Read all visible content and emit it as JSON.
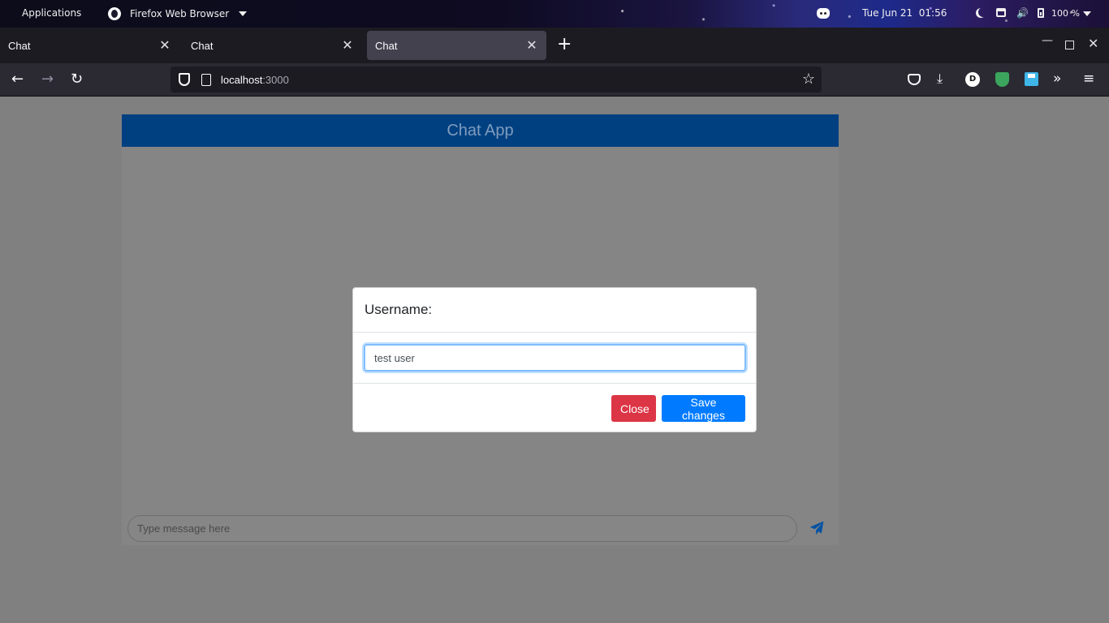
{
  "topbar": {
    "applications": "Applications",
    "app_name": "Firefox Web Browser",
    "clock": "Tue Jun 21  01:56",
    "battery_pct": "100 %"
  },
  "tabs": [
    {
      "title": "Chat",
      "active": false
    },
    {
      "title": "Chat",
      "active": false
    },
    {
      "title": "Chat",
      "active": true
    }
  ],
  "urlbar": {
    "host": "localhost",
    "port": ":3000"
  },
  "chat": {
    "header_title": "Chat App",
    "message_placeholder": "Type message here"
  },
  "modal": {
    "title": "Username:",
    "input_value": "test user",
    "close_label": "Close",
    "save_label": "Save changes"
  },
  "colors": {
    "chat_header_bg": "#004080",
    "close_button": "#dc3545",
    "save_button": "#007bff",
    "send_icon": "#0052a3"
  }
}
